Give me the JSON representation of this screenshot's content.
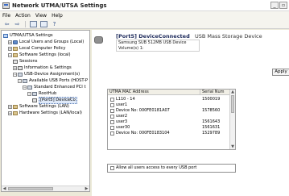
{
  "window": {
    "title": "Network UTMA/UTSA Settings"
  },
  "menu": {
    "items": [
      "File",
      "Action",
      "View",
      "Help"
    ]
  },
  "toolbar": {
    "buttons": [
      {
        "icon": "back-arrow-icon",
        "glyph": "⇦"
      },
      {
        "icon": "forward-arrow-icon",
        "glyph": "⇨"
      },
      {
        "icon": "show-hide-tree-icon",
        "glyph": ""
      },
      {
        "icon": "properties-icon",
        "glyph": ""
      },
      {
        "icon": "help-icon",
        "glyph": "?"
      }
    ]
  },
  "tree": {
    "items": [
      {
        "label": "UTMA/UTSA Settings",
        "icon": "root",
        "expander": "",
        "level": 0
      },
      {
        "label": "Local Users and Groups (Local)",
        "icon": "user",
        "expander": "+",
        "level": 1
      },
      {
        "label": "Local Computer Policy",
        "icon": "settings",
        "expander": "+",
        "level": 1
      },
      {
        "label": "Software Settings (local)",
        "icon": "settings",
        "expander": "−",
        "level": 1
      },
      {
        "label": "Sessions",
        "icon": "device",
        "expander": "",
        "level": 2
      },
      {
        "label": "Information & Settings",
        "icon": "device",
        "expander": "+",
        "level": 2
      },
      {
        "label": "USB-Device Assignment(s)",
        "icon": "usb",
        "expander": "−",
        "level": 2
      },
      {
        "label": "Available USB Ports (HOST-P",
        "icon": "usb",
        "expander": "−",
        "level": 3
      },
      {
        "label": "Standard Enhanced PCI t",
        "icon": "usb",
        "expander": "−",
        "level": 4
      },
      {
        "label": "RootHub",
        "icon": "usb",
        "expander": "−",
        "level": 5
      },
      {
        "label": "[Port5] DeviceCo",
        "icon": "device",
        "expander": "",
        "level": 6,
        "selected": true
      },
      {
        "label": "Software Settings (LAN)",
        "icon": "settings",
        "expander": "+",
        "level": 1
      },
      {
        "label": "Hardware Settings (LAN/local)",
        "icon": "settings",
        "expander": "+",
        "level": 1
      }
    ]
  },
  "device": {
    "title": "[Port5] DeviceConnected",
    "subtitle": "USB Mass Storage Device",
    "line1": "Samsung SUB 512MB USB Device",
    "line2": "Volume(s) 1:"
  },
  "apply": {
    "label": "Apply"
  },
  "grid": {
    "columns": {
      "mac": "UTMA MAC Address",
      "serial": "Serial Num"
    },
    "rows": [
      {
        "mac": "L110 - 14",
        "serial": "1500019"
      },
      {
        "mac": "user1",
        "serial": ""
      },
      {
        "mac": "Device No: 000FE0181A07",
        "serial": "1578560"
      },
      {
        "mac": "user2",
        "serial": ""
      },
      {
        "mac": "user3",
        "serial": "1561643"
      },
      {
        "mac": "user30",
        "serial": "1561631"
      },
      {
        "mac": "Device No: 000FE0183104",
        "serial": "1529789"
      }
    ]
  },
  "allow": {
    "label": "Allow all users access to every USB port"
  }
}
